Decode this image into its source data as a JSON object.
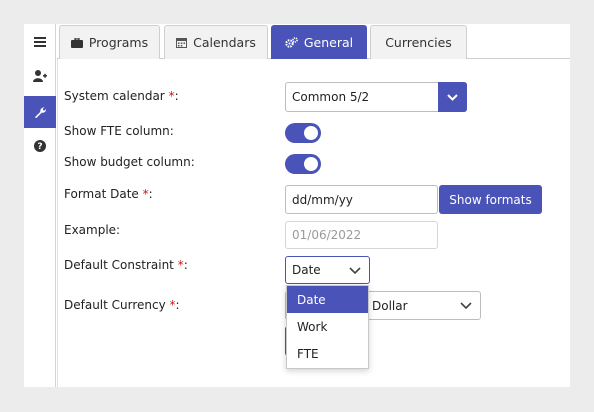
{
  "rail": {
    "items": [
      {
        "icon": "list-icon"
      },
      {
        "icon": "add-user-icon"
      },
      {
        "icon": "wrench-icon",
        "active": true
      },
      {
        "icon": "help-icon"
      }
    ]
  },
  "tabs": [
    {
      "label": "Programs",
      "icon": "briefcase-icon"
    },
    {
      "label": "Calendars",
      "icon": "calendar-icon"
    },
    {
      "label": "General",
      "icon": "gears-icon",
      "active": true
    },
    {
      "label": "Currencies"
    }
  ],
  "form": {
    "system_calendar": {
      "label": "System calendar ",
      "required": "*",
      "colon": ":",
      "value": "Common 5/2"
    },
    "show_fte": {
      "label": "Show FTE column:",
      "checked": true
    },
    "show_budget": {
      "label": "Show budget column:",
      "checked": true
    },
    "format_date": {
      "label": "Format Date ",
      "required": "*",
      "colon": ":",
      "value": "dd/mm/yy",
      "button": "Show formats"
    },
    "example": {
      "label": "Example:",
      "value": "01/06/2022"
    },
    "default_constraint": {
      "label": "Default Constraint ",
      "required": "*",
      "colon": ":",
      "value": "Date",
      "options": [
        "Date",
        "Work",
        "FTE"
      ]
    },
    "default_currency": {
      "label": "Default Currency ",
      "required": "*",
      "colon": ":",
      "value": "Dollar"
    }
  },
  "colors": {
    "accent": "#4a53b8",
    "required": "#d01515"
  }
}
